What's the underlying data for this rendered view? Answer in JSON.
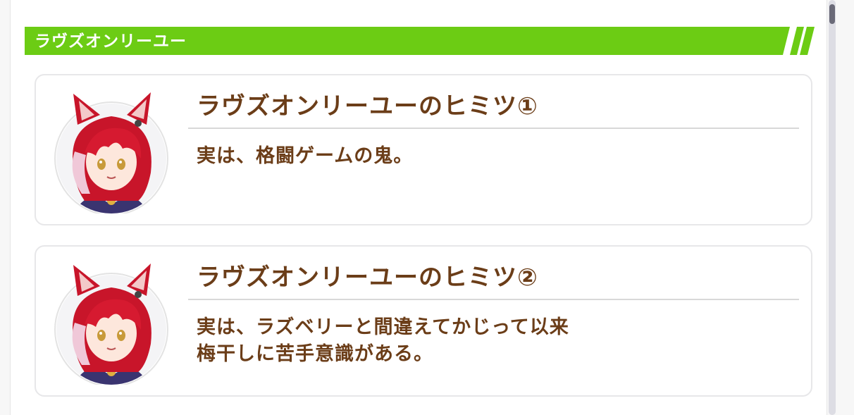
{
  "section": {
    "title": "ラヴズオンリーユー"
  },
  "secrets": [
    {
      "title": "ラヴズオンリーユーのヒミツ①",
      "body_lines": [
        "実は、格闘ゲームの鬼。"
      ],
      "avatar_icon": "character-portrait-icon"
    },
    {
      "title": "ラヴズオンリーユーのヒミツ②",
      "body_lines": [
        "実は、ラズベリーと間違えてかじって以来",
        "梅干しに苦手意識がある。"
      ],
      "avatar_icon": "character-portrait-icon"
    }
  ],
  "colors": {
    "header_green": "#6ccc14",
    "text_brown": "#6b3d18",
    "card_border": "#e7e7e9",
    "scroll_thumb": "#6a6a78"
  }
}
